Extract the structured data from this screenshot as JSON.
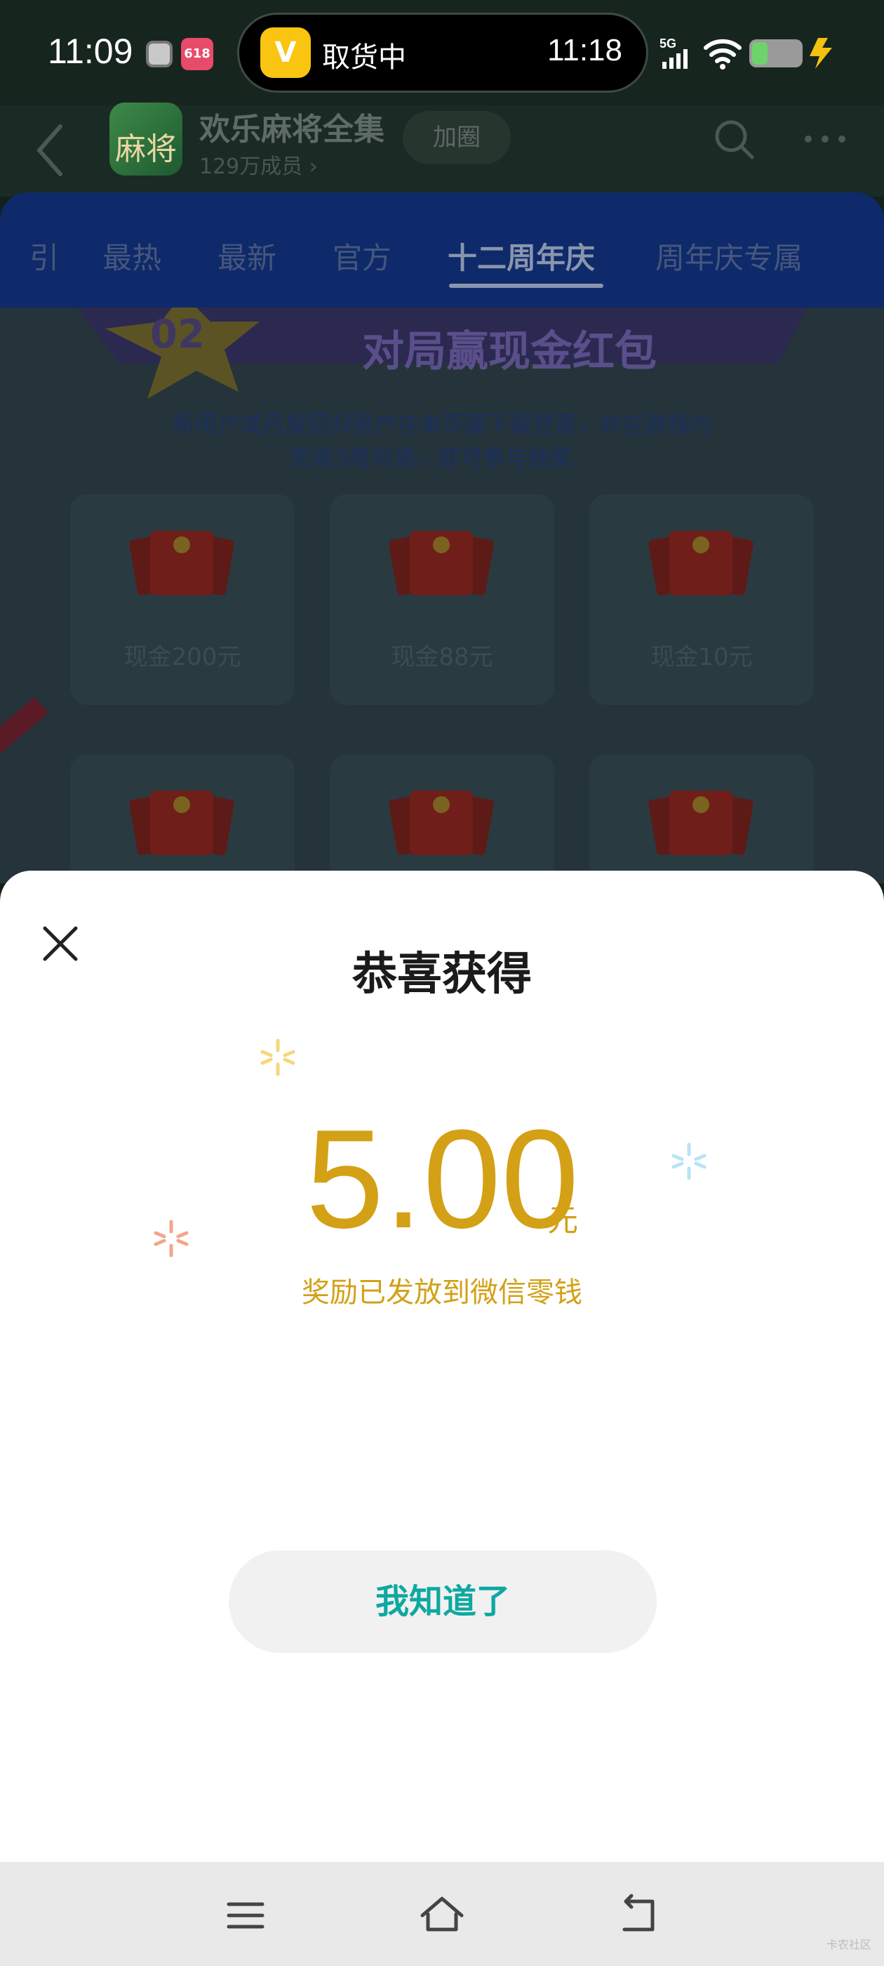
{
  "status_bar": {
    "time": "11:09",
    "live_activity": {
      "status": "取货中",
      "time": "11:18",
      "app_letter": "V"
    },
    "network": "5G",
    "badge_text": "618"
  },
  "header": {
    "app_title": "欢乐麻将全集",
    "members": "129万成员 ›",
    "join_label": "加圈",
    "logo_text": "麻将"
  },
  "tabs": [
    {
      "label": "引"
    },
    {
      "label": "最热"
    },
    {
      "label": "最新"
    },
    {
      "label": "官方"
    },
    {
      "label": "十二周年庆",
      "active": true
    },
    {
      "label": "周年庆专属"
    }
  ],
  "banner": {
    "number": "02",
    "title": "对局赢现金红包"
  },
  "description": {
    "line1": "新用户或月度回归用户在本页面下载登录，并在游戏内",
    "line2": "完成3局对局，即可参与抽奖。"
  },
  "prizes": [
    {
      "label": "现金200元"
    },
    {
      "label": "现金88元"
    },
    {
      "label": "现金10元"
    }
  ],
  "dialog": {
    "title": "恭喜获得",
    "amount": "5.00",
    "unit": "元",
    "note": "奖励已发放到微信零钱",
    "confirm_label": "我知道了"
  },
  "colors": {
    "accent_gold": "#d3a016",
    "button_text_teal": "#0ea8a1",
    "tab_bar_blue": "#0e2a6a"
  },
  "navigation": {
    "icons": [
      "menu-icon",
      "home-icon",
      "back-icon"
    ]
  },
  "watermark": "卡农社区"
}
